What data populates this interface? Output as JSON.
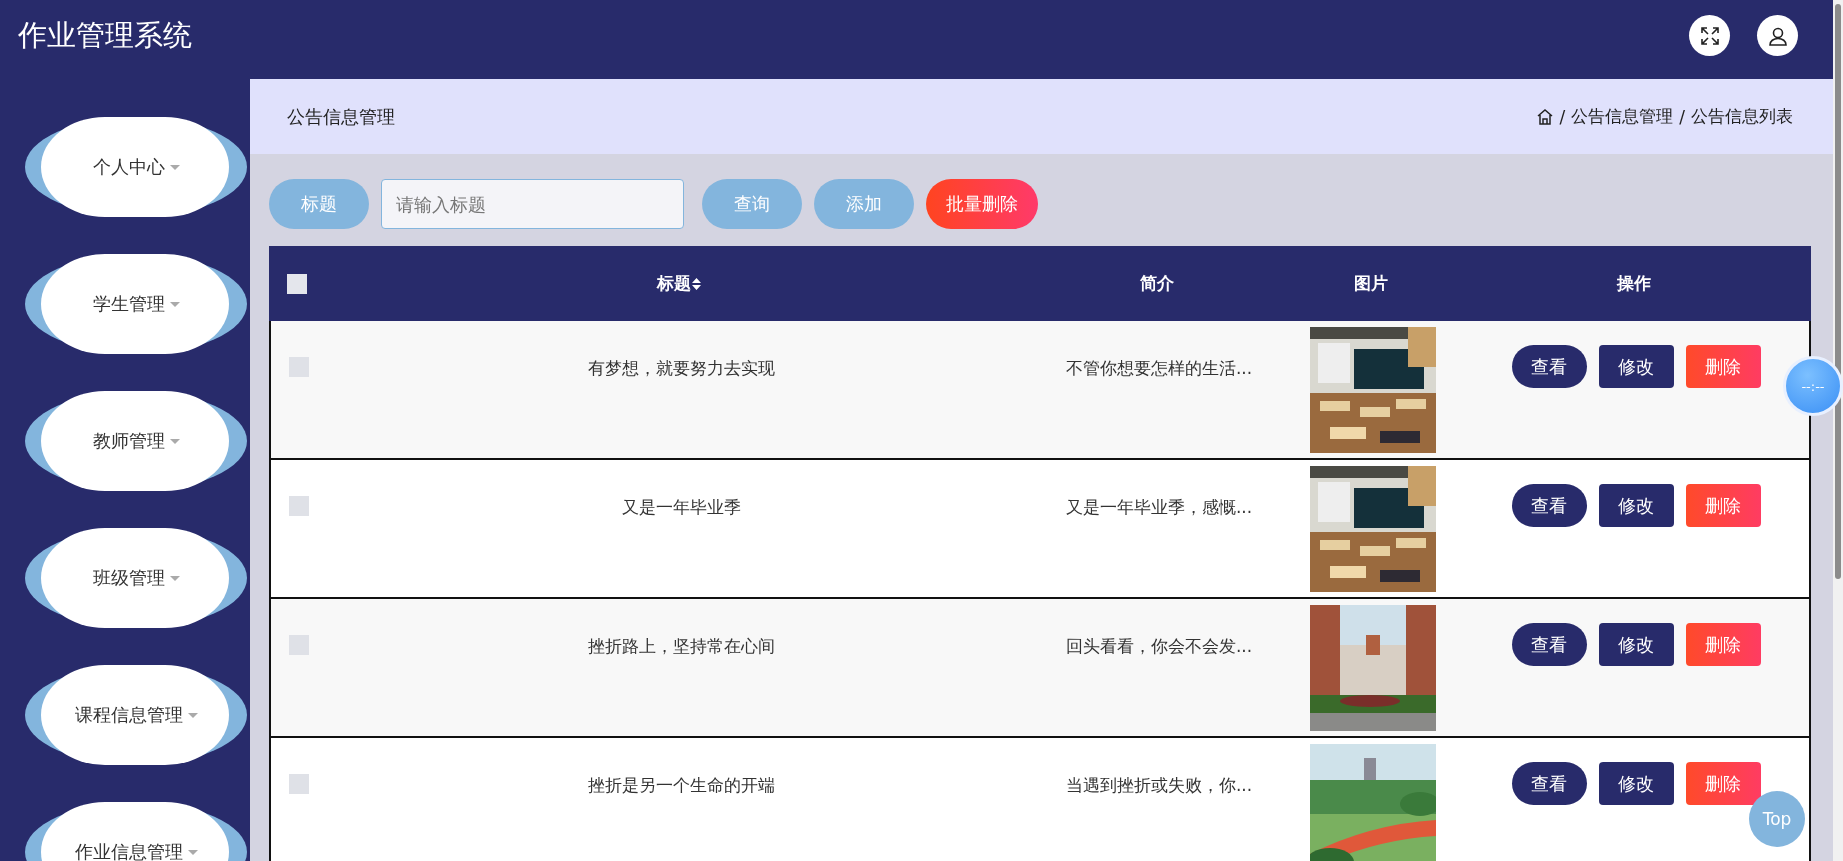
{
  "app": {
    "title": "作业管理系统"
  },
  "sidebar": {
    "items": [
      {
        "label": "个人中心"
      },
      {
        "label": "学生管理"
      },
      {
        "label": "教师管理"
      },
      {
        "label": "班级管理"
      },
      {
        "label": "课程信息管理"
      },
      {
        "label": "作业信息管理"
      }
    ]
  },
  "page": {
    "title": "公告信息管理",
    "separator": "/",
    "breadcrumb": [
      "公告信息管理",
      "公告信息列表"
    ]
  },
  "search": {
    "label": "标题",
    "placeholder": "请输入标题",
    "buttons": [
      {
        "label": "查询",
        "kind": "query"
      },
      {
        "label": "添加",
        "kind": "add"
      },
      {
        "label": "批量删除",
        "kind": "danger"
      }
    ]
  },
  "table": {
    "header_checked": false,
    "columns": [
      "标题",
      "简介",
      "图片",
      "操作"
    ],
    "rows": [
      {
        "checked": false,
        "title": "有梦想，就要努力去实现",
        "intro": "不管你想要怎样的生活...",
        "image": {
          "kind": "picture"
        },
        "actions": [
          {
            "label": "查看",
            "kind": "view"
          },
          {
            "label": "修改",
            "kind": "edit"
          },
          {
            "label": "删除",
            "kind": "delete"
          }
        ]
      },
      {
        "checked": false,
        "title": "又是一年毕业季",
        "intro": "又是一年毕业季，感慨...",
        "image": {
          "kind": "picture"
        },
        "actions": [
          {
            "label": "查看",
            "kind": "view"
          },
          {
            "label": "修改",
            "kind": "edit"
          },
          {
            "label": "删除",
            "kind": "delete"
          }
        ]
      },
      {
        "checked": false,
        "title": "挫折路上，坚持常在心间",
        "intro": "回头看看，你会不会发...",
        "image": {
          "kind": "picture"
        },
        "actions": [
          {
            "label": "查看",
            "kind": "view"
          },
          {
            "label": "修改",
            "kind": "edit"
          },
          {
            "label": "删除",
            "kind": "delete"
          }
        ]
      },
      {
        "checked": false,
        "title": "挫折是另一个生命的开端",
        "intro": "当遇到挫折或失败，你...",
        "image": {
          "kind": "picture"
        },
        "actions": [
          {
            "label": "查看",
            "kind": "view"
          },
          {
            "label": "修改",
            "kind": "edit"
          },
          {
            "label": "删除",
            "kind": "delete"
          }
        ]
      }
    ]
  },
  "widgets": {
    "clock": "--:--",
    "top": "Top"
  }
}
